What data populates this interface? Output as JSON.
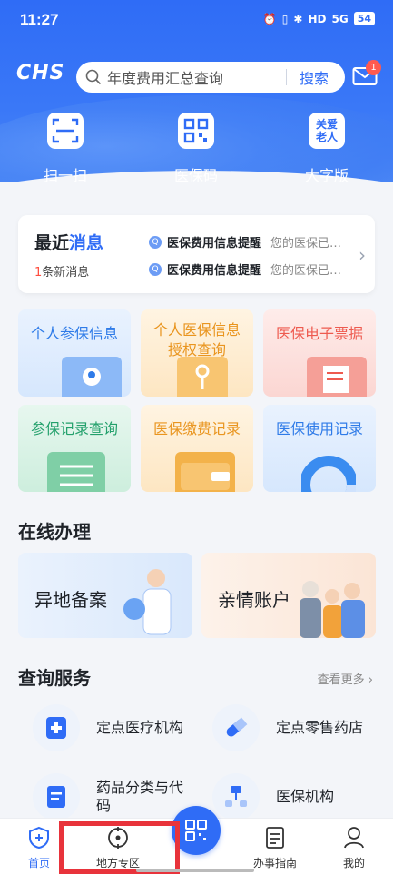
{
  "status": {
    "time": "11:27",
    "network": "HD",
    "signal": "5G",
    "battery": "54"
  },
  "header": {
    "logo": "CHS",
    "search_placeholder": "年度费用汇总查询",
    "search_button": "搜索",
    "mail_badge": "1"
  },
  "quick_actions": [
    {
      "label": "扫一扫",
      "icon": "scan-icon"
    },
    {
      "label": "医保码",
      "icon": "qr-code-icon"
    },
    {
      "label": "大字版",
      "icon": "elderly-care-icon",
      "icon_text": "关爱老人"
    }
  ],
  "news": {
    "title_a": "最近",
    "title_b": "消息",
    "count": "1",
    "count_suffix": "条新消息",
    "items": [
      {
        "title": "医保费用信息提醒",
        "preview": "您的医保已…"
      },
      {
        "title": "医保费用信息提醒",
        "preview": "您的医保已…"
      }
    ]
  },
  "tiles": [
    {
      "label": "个人参保信息",
      "color": "#2f7be8"
    },
    {
      "label": "个人医保信息授权查询",
      "line1": "个人医保信息",
      "line2": "授权查询",
      "color": "#e9951f"
    },
    {
      "label": "医保电子票据",
      "color": "#ee5a4f"
    },
    {
      "label": "参保记录查询",
      "color": "#22a06b"
    },
    {
      "label": "医保缴费记录",
      "color": "#e9951f"
    },
    {
      "label": "医保使用记录",
      "color": "#2f7be8"
    }
  ],
  "online": {
    "heading": "在线办理",
    "cards": [
      {
        "label": "异地备案"
      },
      {
        "label": "亲情账户"
      }
    ]
  },
  "query": {
    "heading": "查询服务",
    "more": "查看更多",
    "items": [
      {
        "label": "定点医疗机构",
        "icon": "hospital-icon"
      },
      {
        "label": "定点零售药店",
        "icon": "pill-icon"
      },
      {
        "label": "药品分类与代码",
        "line1": "药品分类与代",
        "line2": "码",
        "icon": "document-icon"
      },
      {
        "label": "医保机构",
        "icon": "organization-icon"
      }
    ]
  },
  "tabbar": {
    "items": [
      {
        "label": "首页",
        "icon": "home-shield-icon",
        "active": true
      },
      {
        "label": "地方专区",
        "icon": "location-target-icon"
      },
      {
        "label": "办事指南",
        "icon": "guide-document-icon"
      },
      {
        "label": "我的",
        "icon": "user-icon"
      }
    ]
  },
  "colors": {
    "primary": "#2f6cf6",
    "highlight": "#e8333b",
    "badge": "#ff5a4f"
  }
}
